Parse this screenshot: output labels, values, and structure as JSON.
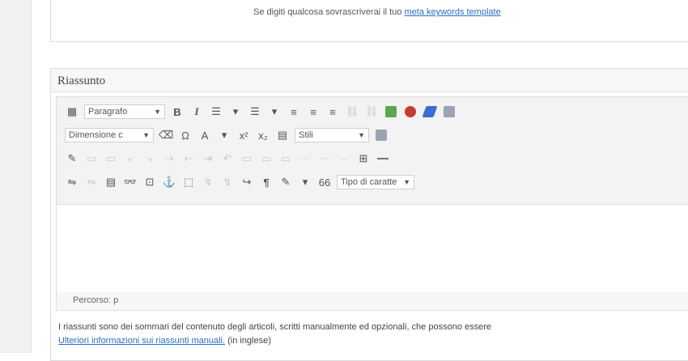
{
  "top_hint": {
    "text": "Se digiti qualcosa sovrascriverai il tuo",
    "link": "meta keywords template"
  },
  "summary": {
    "title": "Riassunto"
  },
  "toolbar": {
    "format_select": "Paragrafo",
    "size_select": "Dimensione c",
    "styles_select": "Stili",
    "font_select": "Tipo di caratte",
    "glyphs": {
      "kitchen_sink": "▦",
      "bold": "B",
      "italic": "I",
      "ul": "☰",
      "ol": "☰",
      "align_left": "≡",
      "align_center": "≡",
      "align_right": "≡",
      "link": "⛓",
      "unlink": "⛓",
      "image": "▣",
      "help": "●",
      "edit": "◆",
      "copy": "⧉",
      "eraser": "⌫",
      "omega": "Ω",
      "color": "A",
      "sup": "x²",
      "sub": "x₂",
      "table": "▤",
      "media": "▣",
      "r3a": "✎",
      "r3b": "▭",
      "r3c": "▭",
      "r3d": "⤶",
      "r3e": "⤷",
      "r3f": "⇢",
      "r3g": "⇠",
      "r3h": "⇥",
      "r3i": "↶",
      "r3j": "▭",
      "r3k": "▭",
      "r3l": "▭",
      "r3m": "⋯",
      "r3n": "⋯",
      "r3o": "⋯",
      "r3p": "⊞",
      "r3q": "—",
      "r4a": "⇋",
      "r4b": "⇋",
      "r4c": "▤",
      "r4d": "👓",
      "r4e": "⊡",
      "r4f": "⚓",
      "r4g": "⬚",
      "r4h": "↯",
      "r4i": "↯",
      "r4j": "↪",
      "r4k": "¶",
      "r4l": "✎",
      "r4m": "66"
    }
  },
  "path": {
    "text": "Percorso: p"
  },
  "help": {
    "line1": "I riassunti sono dei sommari del contenuto degli articoli, scritti manualmente ed opzionali, che possono essere",
    "link": "Ulteriori informazioni sui riassunti manuali.",
    "after_link": "(in inglese)"
  }
}
